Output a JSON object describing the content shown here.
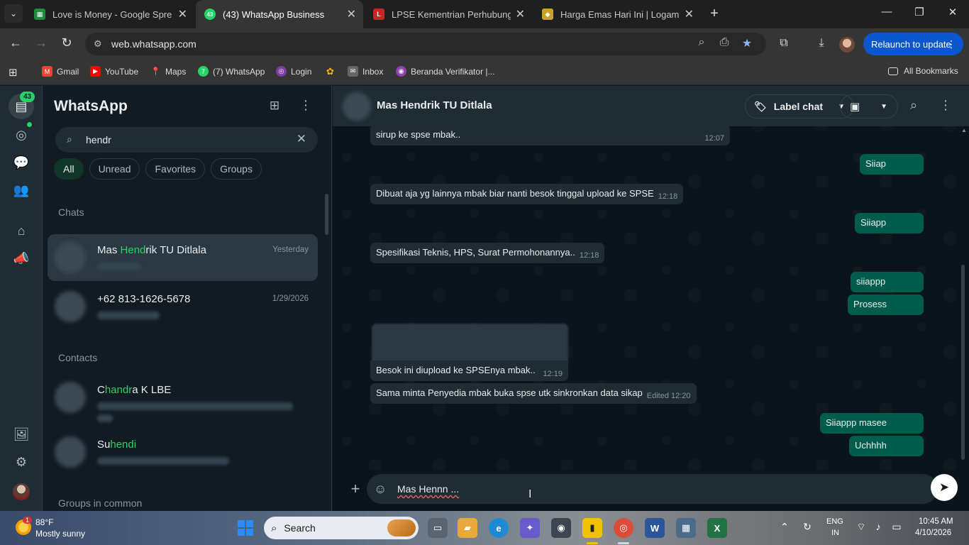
{
  "browser": {
    "tabs": [
      {
        "title": "Love is Money - Google Spread",
        "favicon_color": "#1e8e3e",
        "favicon_glyph": "▦"
      },
      {
        "title": "(43) WhatsApp Business",
        "favicon_color": "#25d366",
        "favicon_glyph": "43"
      },
      {
        "title": "LPSE Kementrian Perhubungan",
        "favicon_color": "#c62828",
        "favicon_glyph": "L"
      },
      {
        "title": "Harga Emas Hari Ini | Logam M",
        "favicon_color": "#c9a227",
        "favicon_glyph": "◆"
      }
    ],
    "new_tab": "+",
    "window_controls": {
      "minimize": "—",
      "maximize": "❐",
      "close": "✕"
    },
    "url": "web.whatsapp.com",
    "relaunch_label": "Relaunch to update",
    "bookmarks": [
      {
        "label": "Gmail",
        "color": "#ea4335",
        "glyph": "M"
      },
      {
        "label": "YouTube",
        "color": "#ff0000",
        "glyph": "▶"
      },
      {
        "label": "Maps",
        "color": "#34a853",
        "glyph": "📍"
      },
      {
        "label": "(7) WhatsApp",
        "color": "#25d366",
        "glyph": "7"
      },
      {
        "label": "Login",
        "color": "#7b3fa0",
        "glyph": "◎"
      },
      {
        "label": "",
        "color": "#f4b400",
        "glyph": "✿"
      },
      {
        "label": "Inbox",
        "color": "#666666",
        "glyph": "✉"
      },
      {
        "label": "Beranda Verifikator |...",
        "color": "#8e44ad",
        "glyph": "◉"
      }
    ],
    "all_bookmarks_label": "All Bookmarks"
  },
  "rail": {
    "unread_badge": "43"
  },
  "sidebar": {
    "title": "WhatsApp",
    "search_value": "hendr",
    "filters": [
      "All",
      "Unread",
      "Favorites",
      "Groups"
    ],
    "chats_header": "Chats",
    "chats": [
      {
        "name_prefix": "Mas ",
        "name_match": "Hend",
        "name_suffix": "rik TU Ditlala",
        "date": "Yesterday"
      },
      {
        "name_prefix": "+62 813-1626-5678",
        "name_match": "",
        "name_suffix": "",
        "date": "1/29/2026"
      }
    ],
    "contacts_header": "Contacts",
    "contacts": [
      {
        "name_prefix": "C",
        "name_match": "handr",
        "name_suffix": "a K LBE"
      },
      {
        "name_prefix": "Su",
        "name_match": "hendi",
        "name_suffix": ""
      }
    ],
    "groups_header": "Groups in common"
  },
  "conversation": {
    "contact_name": "Mas Hendrik TU Ditlala",
    "label_chat": "Label chat",
    "messages": [
      {
        "dir": "in",
        "text": "sirup ke spse mbak..",
        "time": "12:07"
      },
      {
        "dir": "out",
        "text": "Siiap",
        "time": ""
      },
      {
        "dir": "in",
        "text": "Dibuat aja yg lainnya mbak biar nanti besok tinggal upload ke SPSE",
        "time": "12:18"
      },
      {
        "dir": "out",
        "text": "Siiapp",
        "time": ""
      },
      {
        "dir": "in",
        "text": "Spesifikasi Teknis, HPS, Surat Permohonannya..",
        "time": "12:18"
      },
      {
        "dir": "out",
        "text": "siiappp",
        "time": ""
      },
      {
        "dir": "out",
        "text": "Prosess",
        "time": ""
      },
      {
        "dir": "in",
        "text": "Besok ini diupload ke SPSEnya mbak..",
        "time": "12:19"
      },
      {
        "dir": "in",
        "text": "Sama minta Penyedia mbak buka spse utk sinkronkan data sikap",
        "time": "Edited 12:20"
      },
      {
        "dir": "out",
        "text": "Siiappp masee",
        "time": ""
      },
      {
        "dir": "out",
        "text": "Uchhhh",
        "time": ""
      }
    ],
    "composer_text": "Mas Hennn ..."
  },
  "taskbar": {
    "weather_temp": "88°F",
    "weather_desc": "Mostly sunny",
    "weather_badge": "1",
    "search_label": "Search",
    "lang_line1": "ENG",
    "lang_line2": "IN",
    "time": "10:45 AM",
    "date": "4/10/2026"
  }
}
